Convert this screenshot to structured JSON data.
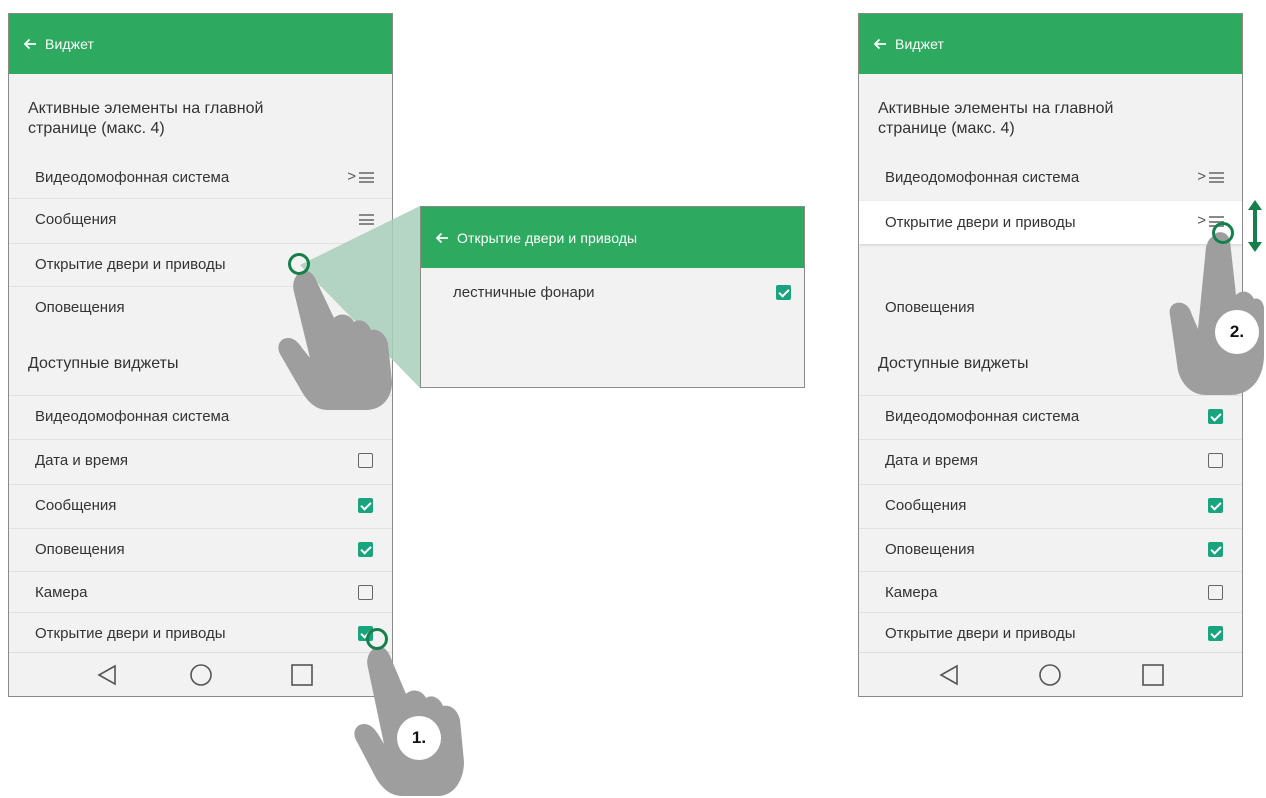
{
  "colors": {
    "appbar": "#2daa5f",
    "checkbox": "#1aa37f",
    "touch_ring": "#14814b",
    "hand": "#999999"
  },
  "left_screen": {
    "appbar_title": "Виджет",
    "active_heading": "Активные элементы на главной странице (макс. 4)",
    "active_items": [
      {
        "label": "Видеодомофонная система",
        "chevron": true,
        "drag": true
      },
      {
        "label": "Сообщения",
        "chevron": false,
        "drag": true
      },
      {
        "label": "Открытие двери и приводы",
        "chevron": false,
        "drag": false
      },
      {
        "label": "Оповещения",
        "chevron": false,
        "drag": false
      }
    ],
    "available_heading": "Доступные виджеты",
    "available_items": [
      {
        "label": "Видеодомофонная система",
        "checked": false
      },
      {
        "label": "Дата и время",
        "checked": false
      },
      {
        "label": "Сообщения",
        "checked": true
      },
      {
        "label": "Оповещения",
        "checked": true
      },
      {
        "label": "Камера",
        "checked": false
      },
      {
        "label": "Открытие двери и приводы",
        "checked": true
      }
    ]
  },
  "popup": {
    "appbar_title": "Открытие двери и приводы",
    "items": [
      {
        "label": "лестничные фонари",
        "checked": true
      }
    ]
  },
  "right_screen": {
    "appbar_title": "Виджет",
    "active_heading": "Активные элементы на главной странице (макс. 4)",
    "active_items": [
      {
        "label": "Видеодомофонная система",
        "chevron": true,
        "drag": true
      },
      {
        "label": "Открытие двери и приводы",
        "chevron": true,
        "drag": true
      },
      {
        "label": "Оповещения",
        "chevron": false,
        "drag": true
      }
    ],
    "available_heading": "Доступные виджеты",
    "available_items": [
      {
        "label": "Видеодомофонная система",
        "checked": true
      },
      {
        "label": "Дата и время",
        "checked": false
      },
      {
        "label": "Сообщения",
        "checked": true
      },
      {
        "label": "Оповещения",
        "checked": true
      },
      {
        "label": "Камера",
        "checked": false
      },
      {
        "label": "Открытие двери и приводы",
        "checked": true
      }
    ]
  },
  "steps": {
    "step1": "1.",
    "step2": "2."
  },
  "icons": [
    "back-arrow-icon",
    "chevron-right-icon",
    "drag-handle-icon",
    "checkbox-icon",
    "nav-back-icon",
    "nav-home-icon",
    "nav-recents-icon",
    "hand-pointer-icon",
    "up-down-arrow-icon"
  ]
}
